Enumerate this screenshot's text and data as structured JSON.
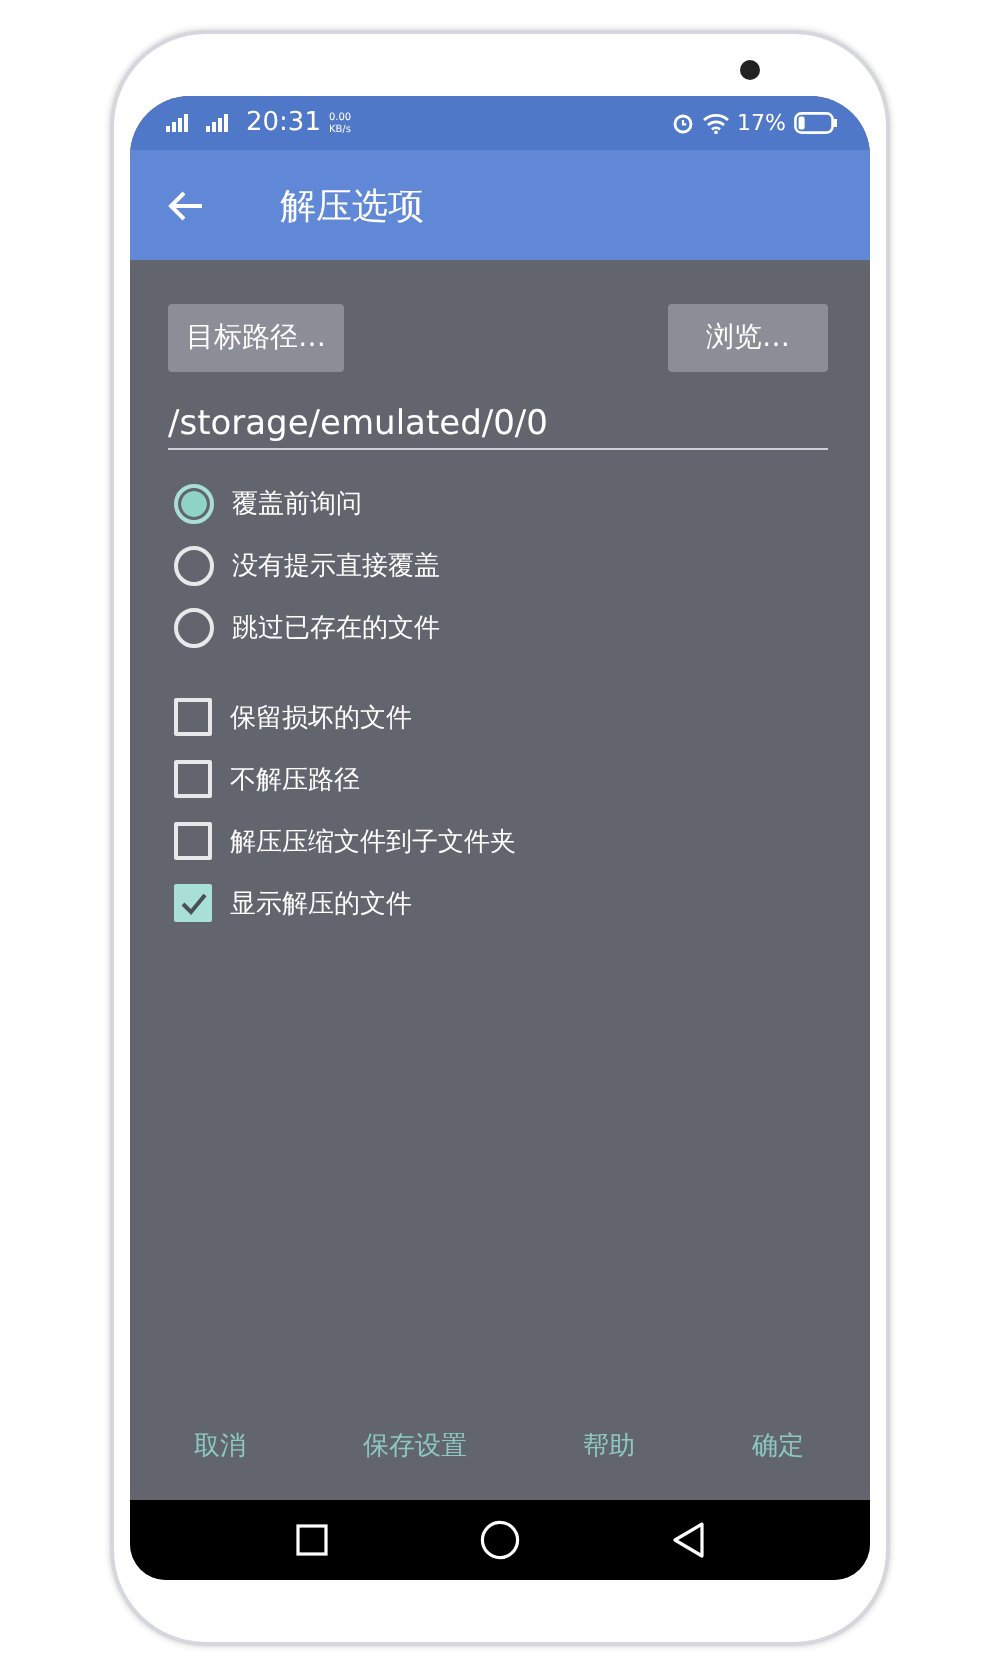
{
  "status_bar": {
    "time": "20:31",
    "speed": "0.00",
    "speed_unit": "KB/s",
    "battery": "17%"
  },
  "app_bar": {
    "title": "解压选项"
  },
  "path_buttons": [
    {
      "label": "目标路径…"
    },
    {
      "label": "浏览…"
    }
  ],
  "path_field": {
    "value": "/storage/emulated/0/0"
  },
  "overwrite_options": [
    {
      "label": "覆盖前询问",
      "selected": true
    },
    {
      "label": "没有提示直接覆盖",
      "selected": false
    },
    {
      "label": "跳过已存在的文件",
      "selected": false
    }
  ],
  "options": [
    {
      "label": "保留损坏的文件",
      "checked": false
    },
    {
      "label": "不解压路径",
      "checked": false
    },
    {
      "label": "解压压缩文件到子文件夹",
      "checked": false
    },
    {
      "label": "显示解压的文件",
      "checked": true
    }
  ],
  "actions": [
    "取消",
    "保存设置",
    "帮助",
    "确定"
  ]
}
